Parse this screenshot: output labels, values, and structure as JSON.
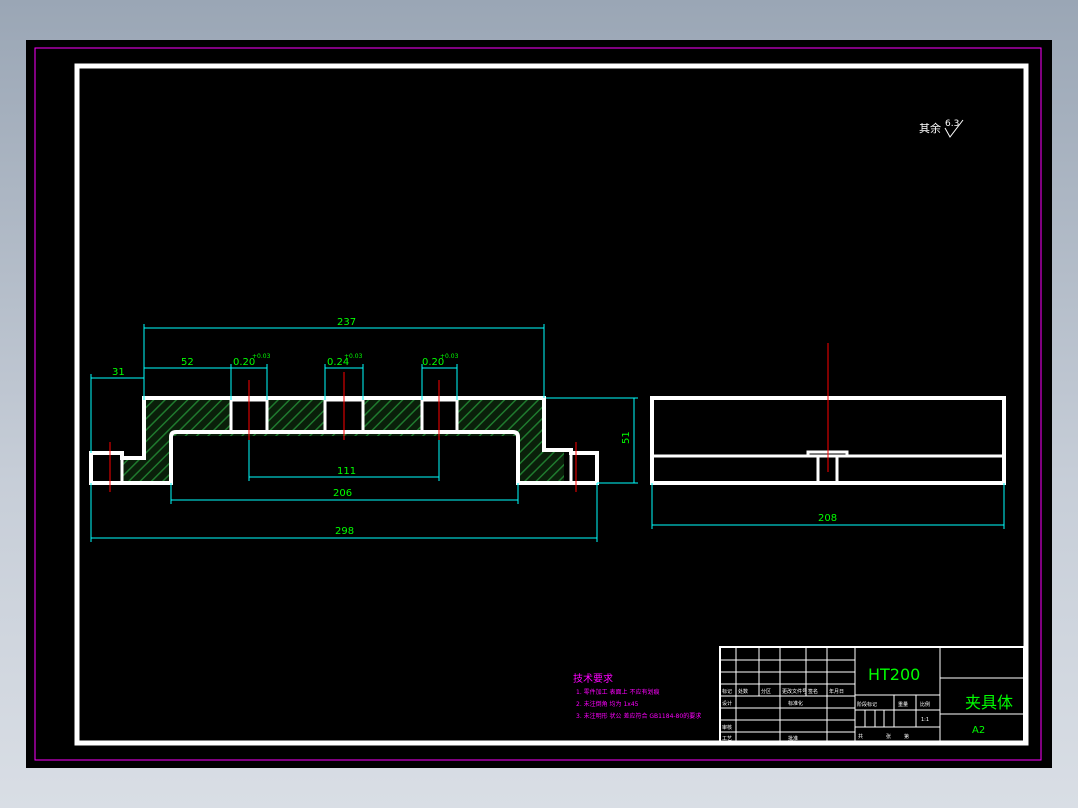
{
  "drawing": {
    "surface_note_prefix": "其余",
    "surface_note_value": "6.3",
    "dimensions": {
      "d237": "237",
      "d52": "52",
      "d31": "31",
      "hole_left": "0.20",
      "hole_left_tol": "+0.03",
      "hole_mid": "0.24",
      "hole_mid_tol": "+0.03",
      "hole_right": "0.20",
      "hole_right_tol": "+0.03",
      "d51": "51",
      "d111": "111",
      "d206": "206",
      "d298": "298",
      "d208": "208"
    },
    "tech_req": {
      "title": "技术要求",
      "items": [
        "1. 零件加工 表面上 不应有划痕",
        "2. 未注倒角 均为 1x45",
        "3. 未注明形 状公 差应符合 GB1184-80的要求"
      ]
    },
    "title_block": {
      "material": "HT200",
      "part_name": "夹具体",
      "sheet_size": "A2",
      "labels": {
        "biaoji": "标记",
        "chushu": "处数",
        "fenqu": "分区",
        "gengaiwenjian": "更改文件号",
        "qianming": "签名",
        "nianyueri": "年月日",
        "sheji": "设计",
        "biaozhunhua": "标准化",
        "jieduan": "阶段标记",
        "zhongliang": "重量",
        "bili": "比例",
        "shenhe": "审核",
        "gongyi": "工艺",
        "pizhun": "批准",
        "gong": "共",
        "zhang": "张",
        "di": "第",
        "scale_val": "1:1"
      }
    },
    "colors": {
      "outline": "#ffffff",
      "dimension": "#00ffff",
      "dim_text": "#00ff00",
      "center": "#ff0000",
      "hatch": "#00b050",
      "border": "#ff00ff",
      "magenta": "#ff00ff"
    }
  }
}
